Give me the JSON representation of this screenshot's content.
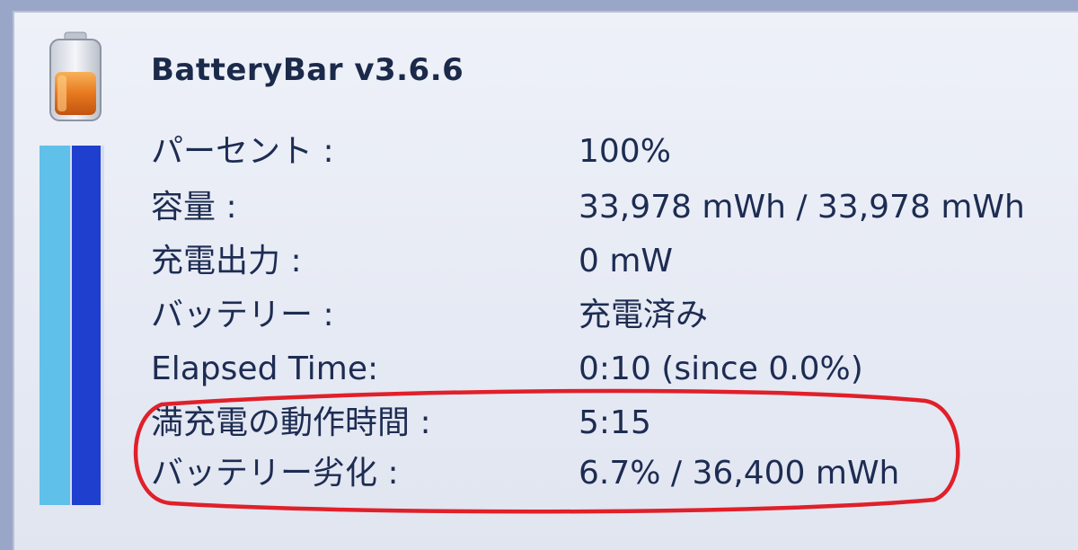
{
  "app": {
    "title": "BatteryBar v3.6.6"
  },
  "battery": {
    "level_fraction": 1.0
  },
  "stats": [
    {
      "label": "パーセント :",
      "value": "100%"
    },
    {
      "label": "容量 :",
      "value": "33,978 mWh / 33,978 mWh"
    },
    {
      "label": "充電出力 :",
      "value": "0 mW"
    },
    {
      "label": "バッテリー :",
      "value": "充電済み"
    },
    {
      "label": "Elapsed Time:",
      "value": "0:10 (since 0.0%)"
    },
    {
      "label": "満充電の動作時間 :",
      "value": "5:15"
    },
    {
      "label": "バッテリー劣化 :",
      "value": "6.7% / 36,400 mWh"
    }
  ],
  "colors": {
    "text": "#1d2c52",
    "bar_light": "#5fc0ea",
    "bar_dark": "#1f3fcf",
    "annotation": "#e0202a"
  }
}
